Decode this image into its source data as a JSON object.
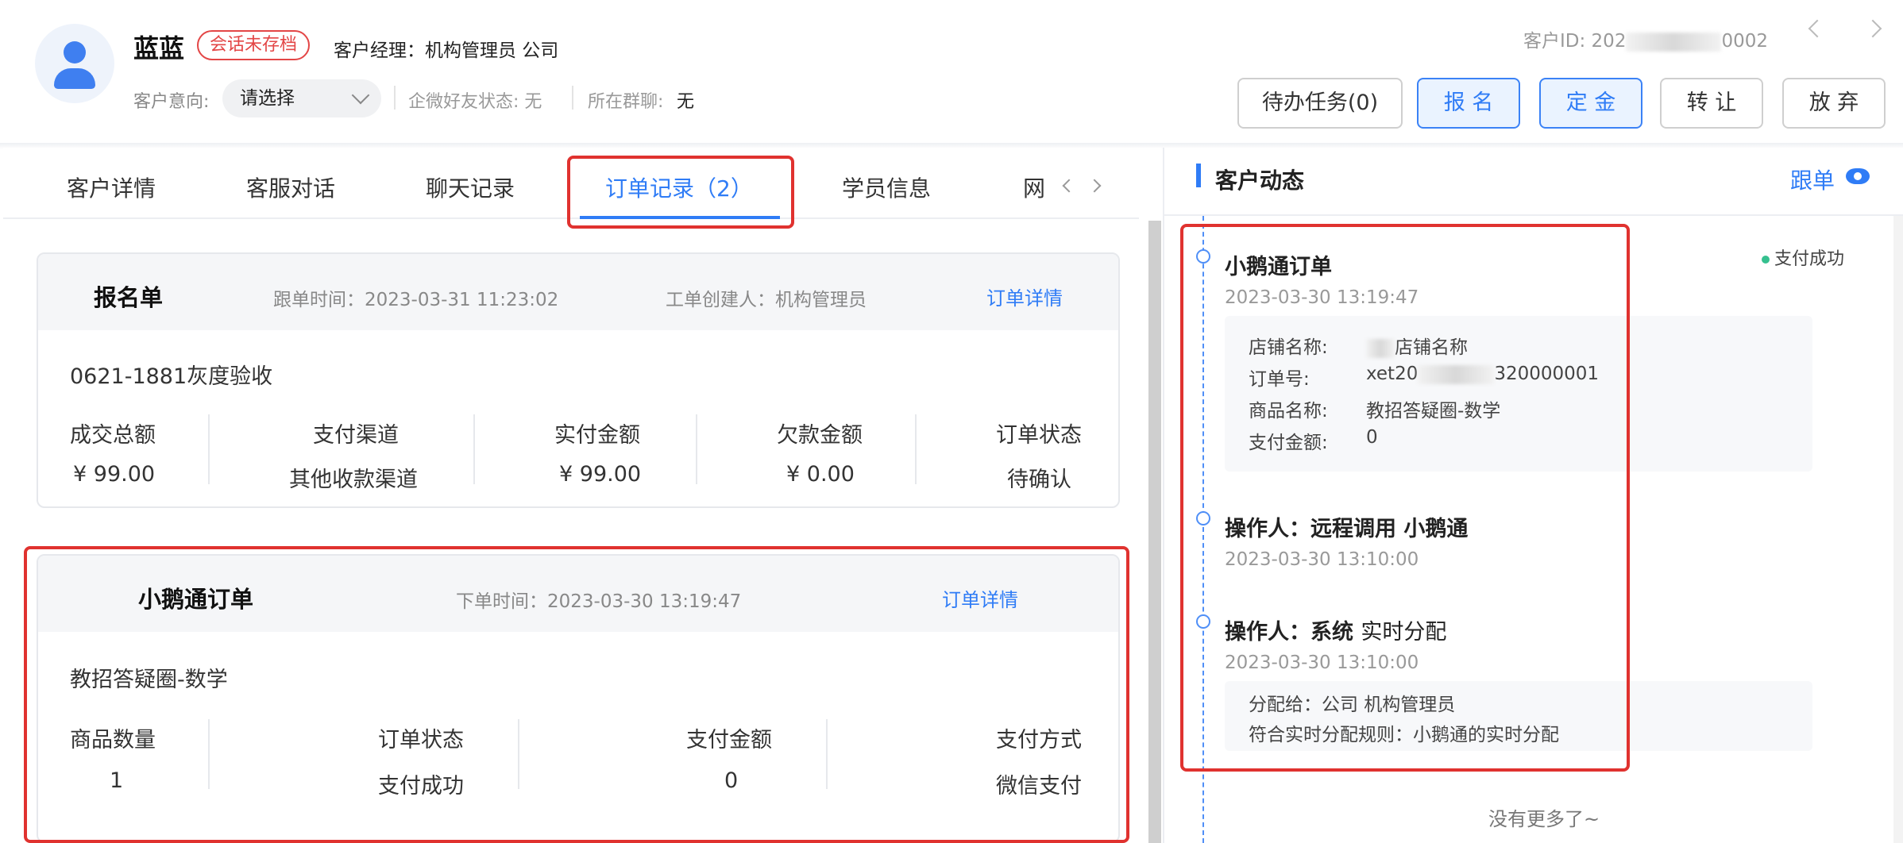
{
  "header": {
    "name": "蓝蓝",
    "unsaved_badge": "会话未存档",
    "manager": "客户经理：机构管理员  公司",
    "intent_label": "客户意向:",
    "intent_value": "请选择",
    "wecom_status": "企微好友状态: 无",
    "group_label": "所在群聊:",
    "group_value": "无",
    "customer_id_prefix": "客户ID: 202",
    "customer_id_suffix": "0002",
    "buttons": {
      "todo": "待办任务(0)",
      "signup": "报 名",
      "deposit": "定 金",
      "transfer": "转 让",
      "abandon": "放 弃"
    }
  },
  "tabs": {
    "detail": "客户详情",
    "service": "客服对话",
    "chat": "聊天记录",
    "orders": "订单记录（2）",
    "student": "学员信息",
    "more": "网"
  },
  "signup_card": {
    "title": "报名单",
    "follow_time": "跟单时间：2023-03-31 11:23:02",
    "creator": "工单创建人：机构管理员",
    "detail_link": "订单详情",
    "product": "0621-1881灰度验收",
    "columns": [
      {
        "label": "成交总额",
        "value": "¥ 99.00"
      },
      {
        "label": "支付渠道",
        "value": "其他收款渠道"
      },
      {
        "label": "实付金额",
        "value": "¥ 99.00"
      },
      {
        "label": "欠款金额",
        "value": "¥ 0.00"
      },
      {
        "label": "订单状态",
        "value": "待确认"
      }
    ]
  },
  "xet_card": {
    "title": "小鹅通订单",
    "order_time": "下单时间：2023-03-30 13:19:47",
    "detail_link": "订单详情",
    "product": "教招答疑圈-数学",
    "columns": [
      {
        "label": "商品数量",
        "value": "1"
      },
      {
        "label": "订单状态",
        "value": "支付成功"
      },
      {
        "label": "支付金额",
        "value": "0"
      },
      {
        "label": "支付方式",
        "value": "微信支付"
      }
    ]
  },
  "dynamics": {
    "title": "客户动态",
    "follow": "跟单",
    "events": [
      {
        "title": "小鹅通订单",
        "time": "2023-03-30 13:19:47",
        "status": "支付成功",
        "store_label": "店铺名称:",
        "store_value": "店铺名称",
        "order_no_label": "订单号:",
        "order_no_prefix": "xet20",
        "order_no_suffix": "320000001",
        "product_label": "商品名称:",
        "product_value": "教招答疑圈-数学",
        "amount_label": "支付金额:",
        "amount_value": "0"
      },
      {
        "title": "操作人：远程调用 小鹅通",
        "time": "2023-03-30 13:10:00"
      },
      {
        "title_bold": "操作人：系统",
        "title_normal": "实时分配",
        "time": "2023-03-30 13:10:00",
        "assign": "分配给：公司 机构管理员",
        "rule": "符合实时分配规则：小鹅通的实时分配"
      }
    ],
    "no_more": "没有更多了~"
  },
  "colors": {
    "accent": "#2f7cf6",
    "highlight": "#e0322f",
    "success": "#35c08f"
  }
}
